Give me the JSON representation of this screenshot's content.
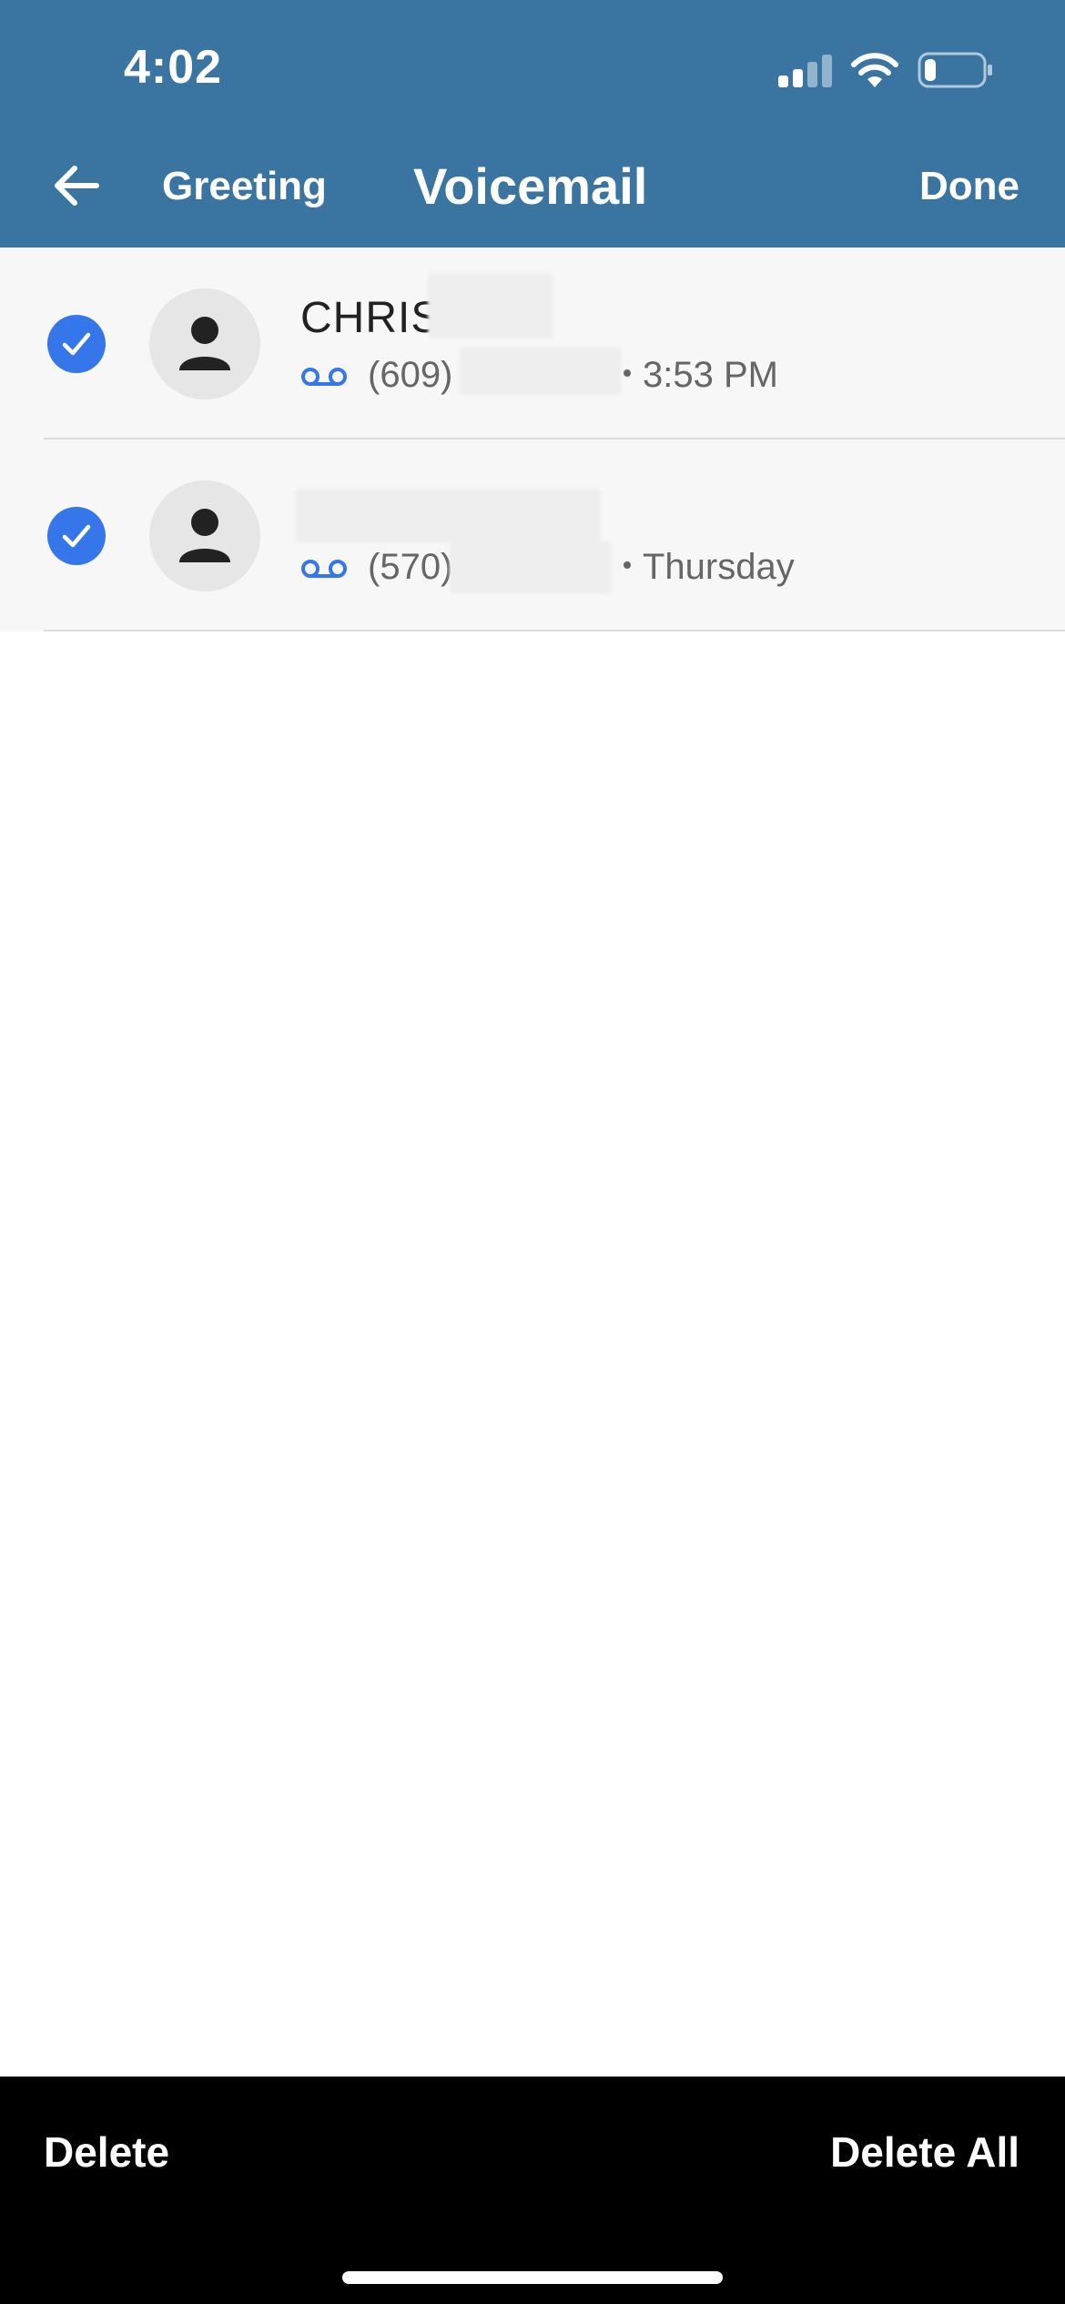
{
  "status_bar": {
    "time": "4:02",
    "signal_icon": "cellular-signal-icon",
    "wifi_icon": "wifi-icon",
    "battery_icon": "battery-icon",
    "battery_level": 0.2
  },
  "nav": {
    "back_icon": "arrow-left-icon",
    "greeting_label": "Greeting",
    "title": "Voicemail",
    "done_label": "Done"
  },
  "voicemails": [
    {
      "selected": true,
      "name": "CHRIS",
      "number_prefix": "(609)",
      "time": "3:53 PM"
    },
    {
      "selected": true,
      "name": "",
      "number_prefix": "(570)",
      "time": "Thursday"
    }
  ],
  "toolbar": {
    "delete_label": "Delete",
    "delete_all_label": "Delete All"
  },
  "colors": {
    "header_bg": "#3a75a2",
    "accent_blue": "#3577ea",
    "toolbar_bg": "#000000"
  }
}
